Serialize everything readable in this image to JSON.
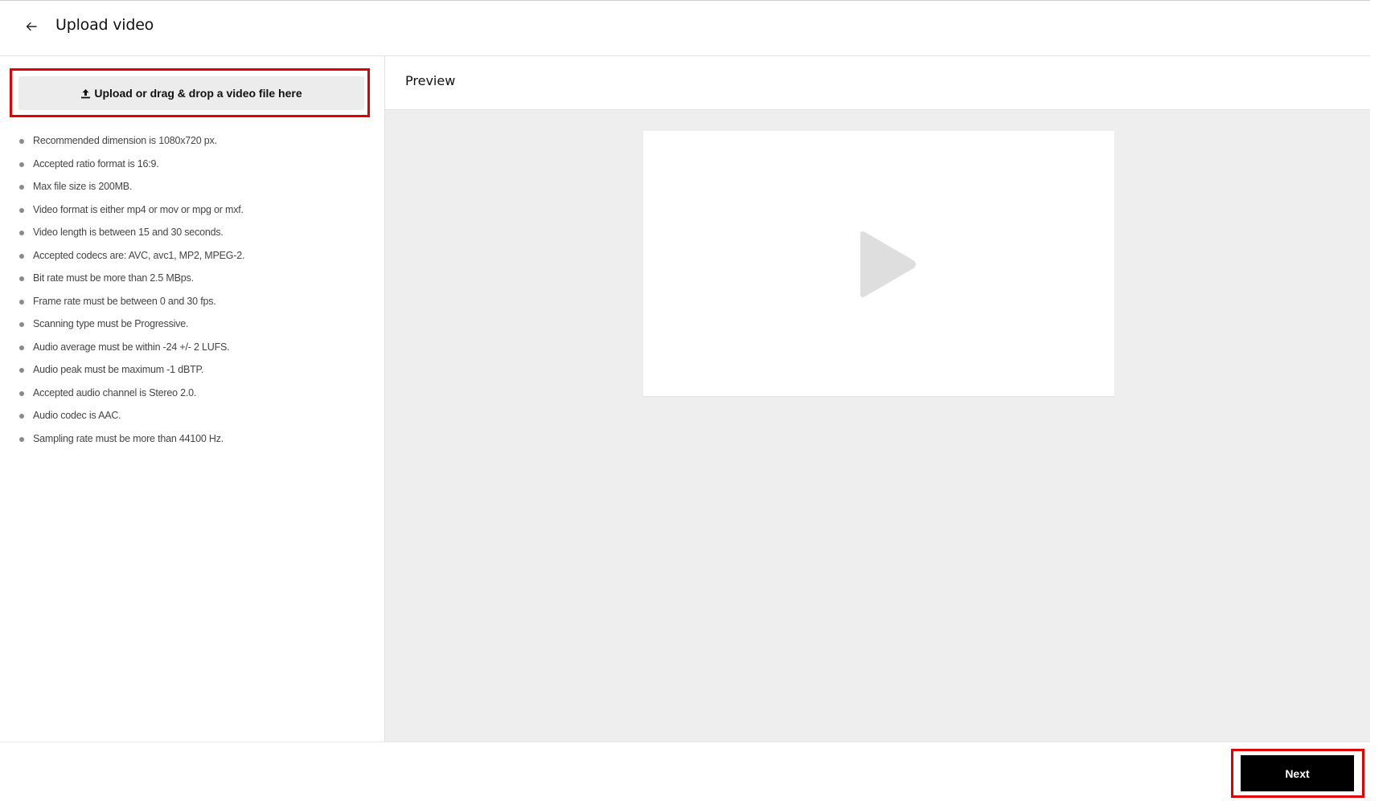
{
  "header": {
    "back_icon": "arrow-left-icon",
    "title": "Upload video"
  },
  "upload": {
    "icon": "upload-icon",
    "label": "Upload or drag & drop a video file here"
  },
  "requirements": [
    "Recommended dimension is 1080x720 px.",
    "Accepted ratio format is 16:9.",
    "Max file size is 200MB.",
    "Video format is either mp4 or mov or mpg or mxf.",
    "Video length is between 15 and 30 seconds.",
    "Accepted codecs are: AVC, avc1, MP2, MPEG-2.",
    "Bit rate must be more than 2.5 MBps.",
    "Frame rate must be between 0 and 30 fps.",
    "Scanning type must be Progressive.",
    "Audio average must be within -24 +/- 2 LUFS.",
    "Audio peak must be maximum -1 dBTP.",
    "Accepted audio channel is Stereo 2.0.",
    "Audio codec is AAC.",
    "Sampling rate must be more than 44100 Hz."
  ],
  "preview": {
    "title": "Preview",
    "play_icon": "play-icon"
  },
  "footer": {
    "next_label": "Next"
  },
  "colors": {
    "highlight": "#e00000",
    "primary_button": "#000000",
    "preview_bg": "#eeeeee",
    "upload_button_bg": "#ececec"
  }
}
